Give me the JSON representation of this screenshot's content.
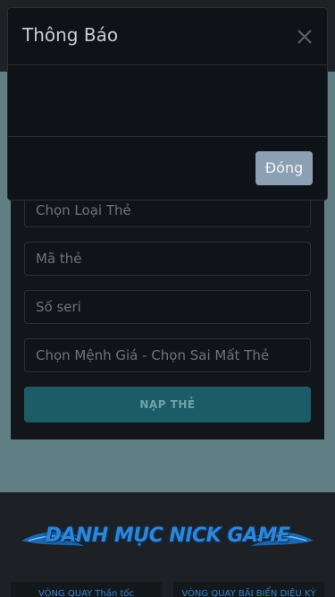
{
  "modal": {
    "title": "Thông Báo",
    "body_text": "",
    "footer_button": "Đóng",
    "close_icon": "close-icon"
  },
  "form": {
    "card_type_placeholder": "Chọn Loại Thẻ",
    "card_code_placeholder": "Mã thẻ",
    "serial_placeholder": "Số seri",
    "denomination_placeholder": "Chọn Mệnh Giá - Chọn Sai Mất Thẻ",
    "submit_label": "NẠP THẺ"
  },
  "catalog": {
    "title": "DANH MỤC NICK GAME",
    "tabs": [
      "VÒNG QUAY Thần tốc",
      "VÒNG QUAY BÃI BIỂN DIỆU KỲ"
    ]
  },
  "colors": {
    "accent_teal": "#1c5c66",
    "banner_blue": "#2f86d6",
    "modal_button": "#8ba0b3"
  }
}
